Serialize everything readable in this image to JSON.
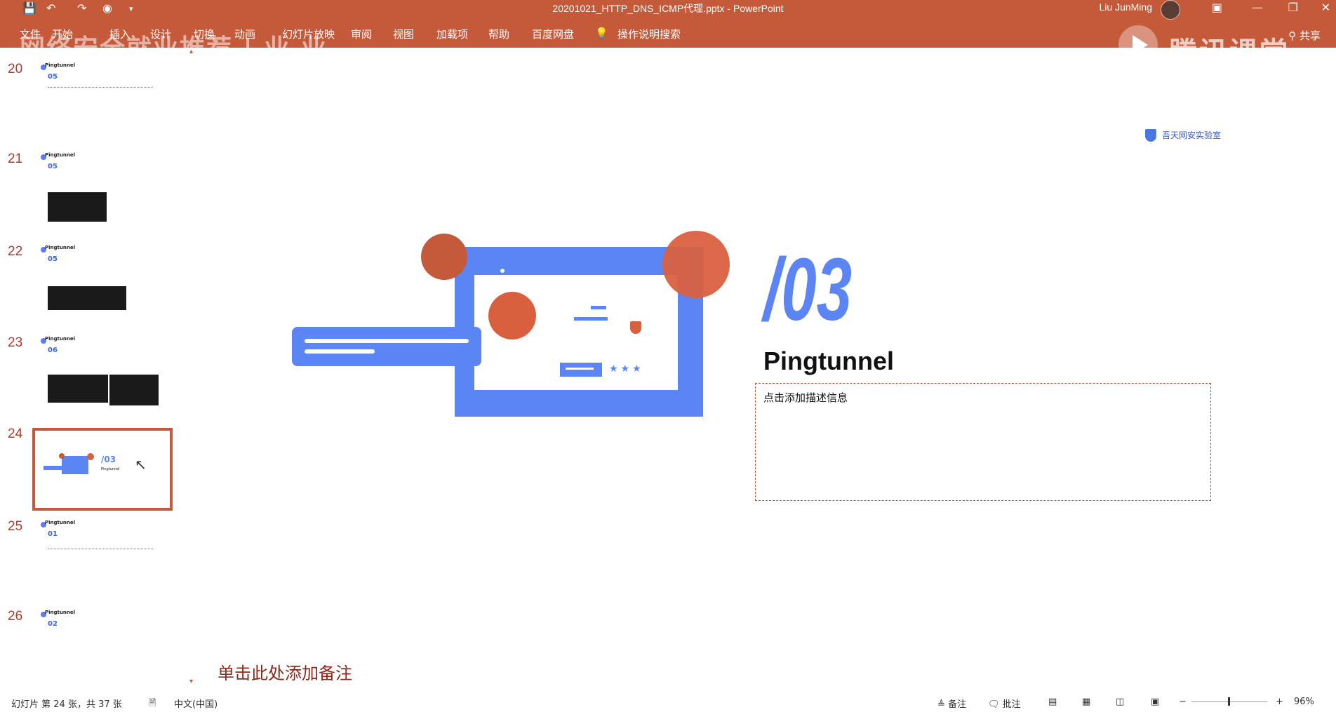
{
  "titlebar": {
    "doc_title": "20201021_HTTP_DNS_ICMP代理.pptx  -  PowerPoint",
    "user_name": "Liu JunMing",
    "quick_access": [
      "save-icon",
      "undo-icon",
      "redo-icon",
      "present-icon",
      "customize-icon"
    ],
    "window_buttons": [
      "ribbon-display-icon",
      "minimize-icon",
      "restore-icon",
      "close-icon"
    ]
  },
  "ribbon": {
    "tabs": [
      "文件",
      "开始",
      "插入",
      "设计",
      "切换",
      "动画",
      "幻灯片放映",
      "审阅",
      "视图",
      "加载项",
      "帮助",
      "百度网盘"
    ],
    "tell_me": "操作说明搜索",
    "share": "共享"
  },
  "overlay": {
    "watermark_text": "网络安全就业推荐 | 业 业",
    "brand_text": "腾讯课堂"
  },
  "thumbnails": [
    {
      "number": "20",
      "heading": "Pingtunnel",
      "section": "05"
    },
    {
      "number": "21",
      "heading": "Pingtunnel",
      "section": "05"
    },
    {
      "number": "22",
      "heading": "Pingtunnel",
      "section": "05"
    },
    {
      "number": "23",
      "heading": "Pingtunnel",
      "section": "06"
    },
    {
      "number": "24",
      "heading": "/03",
      "section": "Pingtunnel",
      "selected": true
    },
    {
      "number": "25",
      "heading": "Pingtunnel",
      "section": "01"
    },
    {
      "number": "26",
      "heading": "Pingtunnel",
      "section": "02"
    }
  ],
  "slide": {
    "logo_text": "吾天网安实验室",
    "number": "/03",
    "title": "Pingtunnel",
    "description_placeholder": "点击添加描述信息",
    "stars": "★★★"
  },
  "notes": {
    "placeholder": "单击此处添加备注"
  },
  "statusbar": {
    "slide_info": "幻灯片 第 24 张，共 37 张",
    "language": "中文(中国)",
    "notes_btn": "备注",
    "comments_btn": "批注",
    "zoom_minus": "−",
    "zoom_plus": "+",
    "zoom_level": "96%"
  }
}
